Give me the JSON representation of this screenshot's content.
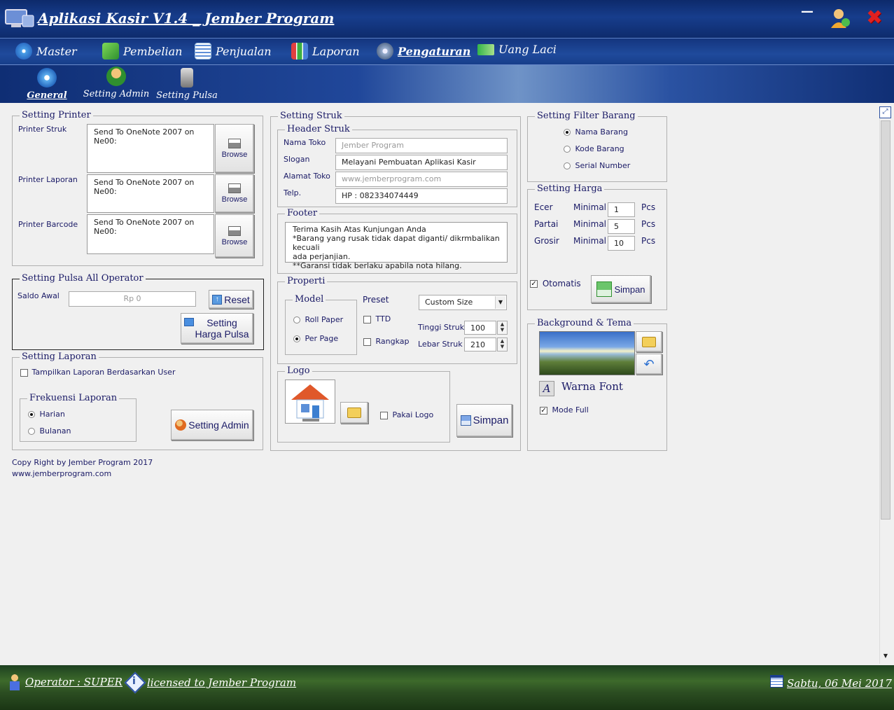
{
  "window": {
    "title": "Aplikasi Kasir V1.4 _ Jember Program",
    "minimize_symbol": "—",
    "close_symbol": "✖"
  },
  "menu": [
    {
      "label": "Master",
      "icon": "disc-icon",
      "color": "#4aa0e8"
    },
    {
      "label": "Pembelian",
      "icon": "cart-icon",
      "color": "#3cb043"
    },
    {
      "label": "Penjualan",
      "icon": "calculator-icon",
      "color": "#5f8fd8"
    },
    {
      "label": "Laporan",
      "icon": "bar-chart-icon",
      "color": "#e04040"
    },
    {
      "label": "Pengaturan",
      "icon": "gear-icon",
      "color": "#9ab0d0"
    },
    {
      "label": "Uang Laci",
      "icon": "money-icon",
      "color": "#33b54a"
    }
  ],
  "submenu": [
    {
      "label": "General",
      "icon": "gear-icon"
    },
    {
      "label": "Setting Admin",
      "icon": "user-icon"
    },
    {
      "label": "Setting Pulsa",
      "icon": "phone-icon"
    }
  ],
  "printer": {
    "legend": "Setting Printer",
    "struk_label": "Printer Struk",
    "laporan_label": "Printer Laporan",
    "barcode_label": "Printer Barcode",
    "struk_value": "Send To OneNote 2007 on Ne00:",
    "laporan_value": "Send To OneNote 2007 on Ne00:",
    "barcode_value": "Send To OneNote 2007 on Ne00:",
    "browse": "Browse"
  },
  "pulsa": {
    "legend": "Setting Pulsa All Operator",
    "saldo_label": "Saldo Awal",
    "saldo_value": "Rp 0",
    "reset": "Reset",
    "setting_harga_line1": "Setting",
    "setting_harga_line2": "Harga Pulsa"
  },
  "laporan": {
    "legend": "Setting Laporan",
    "tampilkan": "Tampilkan Laporan Berdasarkan User",
    "frekuensi_legend": "Frekuensi Laporan",
    "harian": "Harian",
    "bulanan": "Bulanan",
    "setting_admin": "Setting Admin"
  },
  "copyright": {
    "line1": "Copy Right by Jember Program 2017",
    "line2": "www.jemberprogram.com"
  },
  "struk": {
    "legend": "Setting Struk",
    "header_legend": "Header Struk",
    "nama_toko_label": "Nama Toko",
    "nama_toko_value": "Jember Program",
    "slogan_label": "Slogan",
    "slogan_value": "Melayani Pembuatan Aplikasi Kasir",
    "alamat_label": "Alamat Toko",
    "alamat_value": "www.jemberprogram.com",
    "telp_label": "Telp.",
    "telp_value": "HP : 082334074449",
    "footer_legend": "Footer",
    "footer_line1": "Terima Kasih Atas Kunjungan Anda",
    "footer_line2": "*Barang yang rusak tidak dapat diganti/ dikrmbalikan kecuali",
    "footer_line3": "ada perjanjian.",
    "footer_line4": "**Garansi tidak berlaku apabila nota hilang.",
    "properti_legend": "Properti",
    "model_legend": "Model",
    "roll_paper": "Roll Paper",
    "per_page": "Per Page",
    "preset_label": "Preset",
    "preset_value": "Custom Size",
    "ttd": "TTD",
    "rangkap": "Rangkap",
    "tinggi_label": "Tinggi Struk",
    "tinggi_value": "100",
    "lebar_label": "Lebar Struk",
    "lebar_value": "210",
    "logo_legend": "Logo",
    "pakai_logo": "Pakai Logo",
    "simpan": "Simpan"
  },
  "filter": {
    "legend": "Setting Filter Barang",
    "nama_barang": "Nama Barang",
    "kode_barang": "Kode Barang",
    "serial_number": "Serial Number"
  },
  "harga": {
    "legend": "Setting Harga",
    "rows": [
      {
        "name": "Ecer",
        "minimal": "Minimal",
        "value": "1",
        "unit": "Pcs"
      },
      {
        "name": "Partai",
        "minimal": "Minimal",
        "value": "5",
        "unit": "Pcs"
      },
      {
        "name": "Grosir",
        "minimal": "Minimal",
        "value": "10",
        "unit": "Pcs"
      }
    ],
    "otomatis": "Otomatis",
    "simpan": "Simpan"
  },
  "tema": {
    "legend": "Background & Tema",
    "warna_font": "Warna Font",
    "warna_icon_letter": "A",
    "mode_full": "Mode Full"
  },
  "status": {
    "operator": "Operator : SUPER",
    "license": "licensed to Jember Program",
    "date": "Sabtu, 06 Mei 2017"
  }
}
